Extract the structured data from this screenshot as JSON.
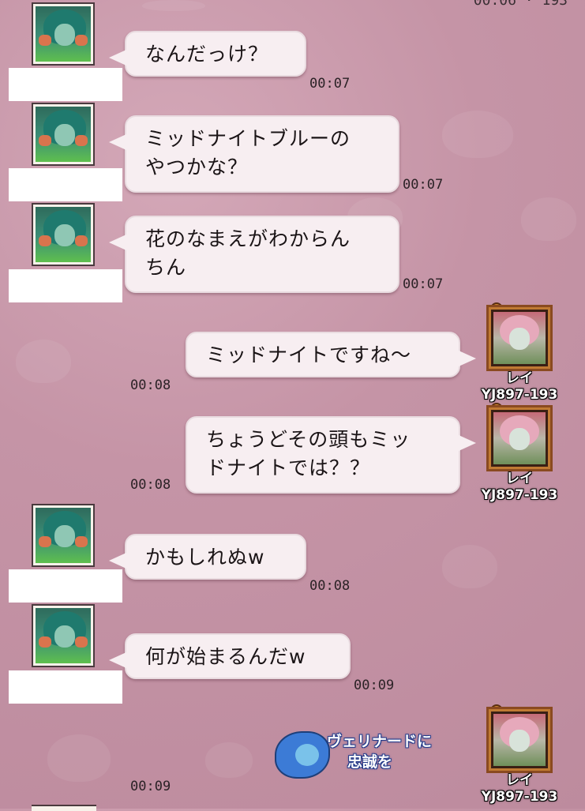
{
  "top_timestamp": "00:06 · 193",
  "messages": [
    {
      "side": "left",
      "text": "なんだっけ？",
      "time": "00:07",
      "avatar": "player-avatar-teal"
    },
    {
      "side": "left",
      "text": "ミッドナイトブルーの\nやつかな？",
      "time": "00:07",
      "avatar": "player-avatar-teal"
    },
    {
      "side": "left",
      "text": "花のなまえがわからん\nちん",
      "time": "00:07",
      "avatar": "player-avatar-teal"
    },
    {
      "side": "right",
      "text": "ミッドナイトですね～",
      "time": "00:08",
      "name": "レイ",
      "id": "YJ897-193"
    },
    {
      "side": "right",
      "text": "ちょうどその頭もミッ\nドナイトでは？？",
      "time": "00:08",
      "name": "レイ",
      "id": "YJ897-193"
    },
    {
      "side": "left",
      "text": "かもしれぬw",
      "time": "00:08",
      "avatar": "player-avatar-teal"
    },
    {
      "side": "left",
      "text": "何が始まるんだw",
      "time": "00:09",
      "avatar": "player-avatar-teal"
    },
    {
      "side": "right",
      "sticker": true,
      "sticker_text_1": "ヴェリナードに",
      "sticker_text_2": "忠誠を",
      "time": "00:09",
      "name": "レイ",
      "id": "YJ897-193"
    }
  ],
  "colors": {
    "background": "#c99aab",
    "bubble": "#f7eef1",
    "text": "#1a1416"
  },
  "icons": {
    "key": "key-icon",
    "left_avatar": "teal-hair-character",
    "right_avatar": "pink-hair-character",
    "sticker": "blue-fish-sticker"
  }
}
